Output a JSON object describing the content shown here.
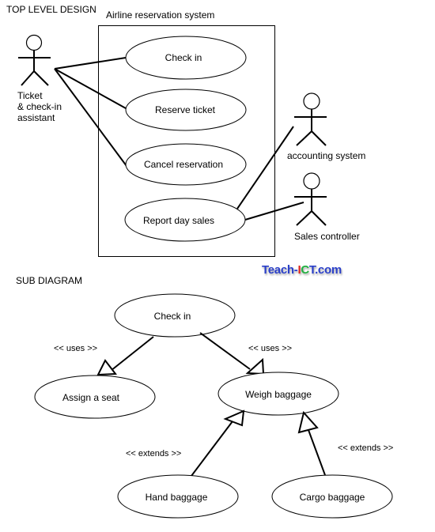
{
  "top": {
    "heading": "TOP LEVEL DESIGN",
    "system_title": "Airline reservation system",
    "actors": {
      "assistant": [
        "Ticket",
        "& check-in",
        "assistant"
      ],
      "accounting": "accounting system",
      "sales": "Sales controller"
    },
    "use_cases": [
      "Check in",
      "Reserve ticket",
      "Cancel reservation",
      "Report day sales"
    ]
  },
  "logo": {
    "part1": "Teach-",
    "part2": "I",
    "part3": "C",
    "part4": "T",
    "part5": ".com",
    "colors": {
      "blue": "#2a3fc9",
      "red": "#e0261b",
      "green": "#22b040"
    }
  },
  "sub": {
    "heading": "SUB DIAGRAM",
    "use_cases": {
      "check_in": "Check in",
      "assign_seat": "Assign a seat",
      "weigh_baggage": "Weigh baggage",
      "hand_baggage": "Hand baggage",
      "cargo_baggage": "Cargo baggage"
    },
    "labels": {
      "uses_left": "<< uses >>",
      "uses_right": "<< uses >>",
      "extends_left": "<< extends >>",
      "extends_right": "<< extends >>"
    }
  }
}
